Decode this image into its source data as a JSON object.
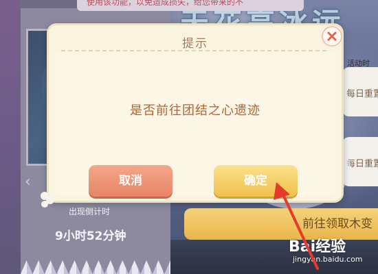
{
  "background": {
    "top_hint": "使用该功能，以免造成损失，给您带来的不",
    "title_art": "天花高冰远",
    "activity_time": "活动时",
    "reset_label": "每日重置",
    "countdown_label": "出现倒计时",
    "countdown_value": "9小时52分钟",
    "collect_button": "前往领取木变",
    "watermark_brand": "Bai经验",
    "watermark_url": "jingyan.baidu.com"
  },
  "dialog": {
    "title": "提示",
    "message": "是否前往团结之心遗迹",
    "cancel_label": "取消",
    "ok_label": "确定"
  },
  "colors": {
    "dialog_bg": "#fbf4e1",
    "cancel_button": "#e78566",
    "ok_button": "#f0c14d",
    "message_text": "#b5622f",
    "annotation_arrow": "#e53a2c"
  },
  "icons": {
    "close": "close-icon",
    "cloud": "cloud-icon",
    "paw": "paw-icon",
    "arrow": "red-arrow-icon"
  }
}
